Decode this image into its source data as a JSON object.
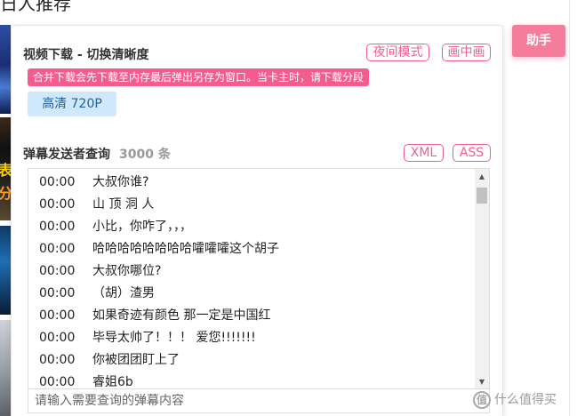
{
  "background": {
    "heading": "日人推荐",
    "thumbnail_glyphs": [
      "表",
      "分"
    ]
  },
  "panel": {
    "video_section": {
      "title": "视频下载 - 切换清晰度",
      "night_mode_label": "夜间模式",
      "pip_label": "画中画",
      "warning": "合并下载会先下载至内存最后弹出另存为窗口。当卡主时，请下载分段",
      "quality_label": "高清 720P"
    },
    "danmaku_section": {
      "title": "弹幕发送者查询",
      "count": "3000 条",
      "xml_label": "XML",
      "ass_label": "ASS",
      "items": [
        {
          "time": "00:00",
          "content": "大叔你谁?"
        },
        {
          "time": "00:00",
          "content": "山 顶 洞 人"
        },
        {
          "time": "00:00",
          "content": "小比，你咋了，，，"
        },
        {
          "time": "00:00",
          "content": "哈哈哈哈哈哈哈哈嚯嚯嚯这个胡子"
        },
        {
          "time": "00:00",
          "content": "大叔你哪位?"
        },
        {
          "time": "00:00",
          "content": "（胡）渣男"
        },
        {
          "time": "00:00",
          "content": "如果奇迹有颜色 那一定是中国红"
        },
        {
          "time": "00:00",
          "content": "毕导太帅了！！！ 爱您!!!!!!!"
        },
        {
          "time": "00:00",
          "content": "你被团团盯上了"
        },
        {
          "time": "00:00",
          "content": "睿姐6b"
        }
      ],
      "search_placeholder": "请输入需要查询的弹幕内容"
    }
  },
  "helper_button_label": "助手",
  "watermark": {
    "icon_glyph": "值",
    "text": "什么值得买"
  },
  "colors": {
    "accent": "#f25d8e",
    "helper_button": "#f57c9a",
    "quality_bg": "#d0e8fb",
    "quality_text": "#1f5f9a"
  }
}
